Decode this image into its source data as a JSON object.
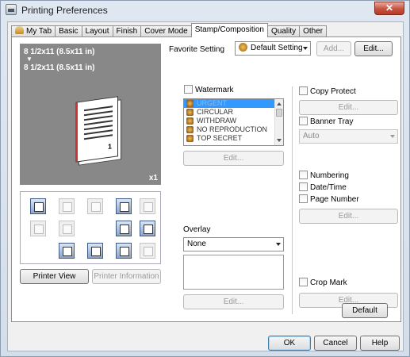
{
  "window": {
    "title": "Printing Preferences",
    "close": "✕"
  },
  "tabs": [
    "My Tab",
    "Basic",
    "Layout",
    "Finish",
    "Cover Mode",
    "Stamp/Composition",
    "Quality",
    "Other"
  ],
  "active_tab": "Stamp/Composition",
  "preview": {
    "original_size": "8 1/2x11 (8.5x11 in)",
    "arrow": "▼",
    "output_size": "8 1/2x11 (8.5x11 in)",
    "page_number": "1",
    "copies": "x1"
  },
  "left_buttons": {
    "printer_view": "Printer View",
    "printer_information": "Printer Information"
  },
  "favorite": {
    "label": "Favorite Setting",
    "value": "Default Setting",
    "add": "Add...",
    "edit": "Edit..."
  },
  "watermark": {
    "label": "Watermark",
    "items": [
      "URGENT",
      "CIRCULAR",
      "WITHDRAW",
      "NO REPRODUCTION",
      "TOP SECRET"
    ],
    "selected": "URGENT",
    "edit": "Edit..."
  },
  "overlay": {
    "label": "Overlay",
    "value": "None",
    "edit": "Edit..."
  },
  "copy_protect": {
    "label": "Copy Protect",
    "edit": "Edit..."
  },
  "banner_tray": {
    "label": "Banner Tray",
    "value": "Auto"
  },
  "numbering": {
    "label": "Numbering",
    "date_time": "Date/Time",
    "page_number": "Page Number",
    "edit": "Edit..."
  },
  "crop_mark": {
    "label": "Crop Mark",
    "edit": "Edit..."
  },
  "default_button": "Default",
  "footer": {
    "ok": "OK",
    "cancel": "Cancel",
    "help": "Help"
  }
}
